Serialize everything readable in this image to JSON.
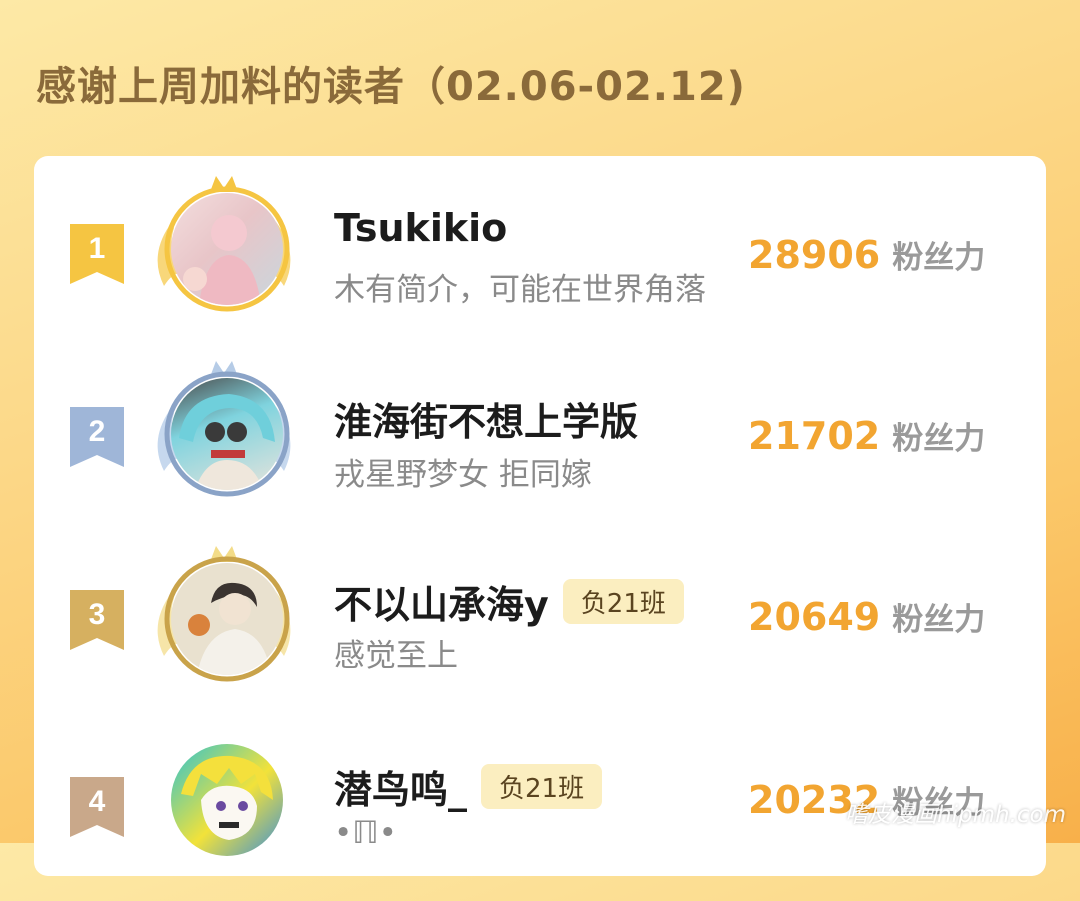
{
  "header": {
    "title": "感谢上周加料的读者（02.06-02.12)"
  },
  "ranking": [
    {
      "rank": "1",
      "name": "Tsukikio",
      "tag": "",
      "bio": "木有简介，可能在世界角落",
      "score": "28906",
      "unit": "粉丝力",
      "badge_color": "#f5c542"
    },
    {
      "rank": "2",
      "name": "淮海街不想上学版",
      "tag": "",
      "bio": "戎星野梦女 拒同嫁",
      "score": "21702",
      "unit": "粉丝力",
      "badge_color": "#9fb6d8"
    },
    {
      "rank": "3",
      "name": "不以山承海y",
      "tag": "负21班",
      "bio": "感觉至上",
      "score": "20649",
      "unit": "粉丝力",
      "badge_color": "#d6b060"
    },
    {
      "rank": "4",
      "name": "潜鸟鸣_",
      "tag": "负21班",
      "bio": "•ℿ•",
      "score": "20232",
      "unit": "粉丝力",
      "badge_color": "#c9a88a"
    }
  ],
  "watermark": "嗜皮漫画hipmh.com",
  "colors": {
    "accent": "#f2a531",
    "gold": "#f5c542",
    "silver": "#9fb6d8",
    "bronze": "#d6b060"
  }
}
